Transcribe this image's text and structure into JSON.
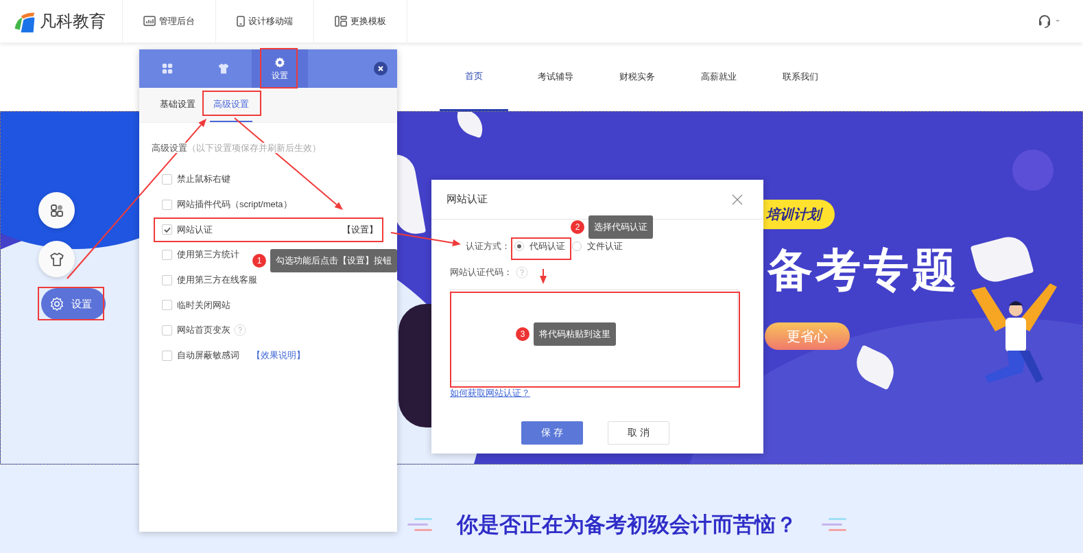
{
  "top_bar": {
    "logo": "凡科教育",
    "tools": [
      {
        "kind": "chart",
        "label": "管理后台"
      },
      {
        "kind": "phone",
        "label": "设计移动端"
      },
      {
        "kind": "layout",
        "label": "更换模板"
      }
    ]
  },
  "site_nav": {
    "items": [
      {
        "label": "首页",
        "selected": true
      },
      {
        "label": "考试辅导",
        "selected": false
      },
      {
        "label": "财税实务",
        "selected": false
      },
      {
        "label": "高薪就业",
        "selected": false
      },
      {
        "label": "联系我们",
        "selected": false
      }
    ]
  },
  "banner": {
    "badge": "培训计划",
    "headline": "备考专题",
    "button": "更省心"
  },
  "float_buttons": [
    {
      "kind": "grid"
    },
    {
      "kind": "shirt"
    },
    {
      "kind": "gear",
      "label": "设置"
    }
  ],
  "panel": {
    "tabs": [
      {
        "kind": "grid",
        "selected": false
      },
      {
        "kind": "shirt",
        "selected": false
      },
      {
        "kind": "gear",
        "label": "设置",
        "selected": true
      }
    ],
    "subtabs": [
      {
        "label": "基础设置",
        "selected": false
      },
      {
        "label": "高级设置",
        "selected": true
      }
    ],
    "section_title": "高级设置",
    "section_note": "（以下设置项保存并刷新后生效）",
    "options": [
      {
        "label": "禁止鼠标右键",
        "checked": false
      },
      {
        "label": "网站插件代码（script/meta）",
        "checked": false
      },
      {
        "label": "网站认证",
        "checked": true,
        "action": "【设置】"
      },
      {
        "label": "使用第三方统计",
        "checked": false
      },
      {
        "label": "使用第三方在线客服",
        "checked": false
      },
      {
        "label": "临时关闭网站",
        "checked": false
      },
      {
        "label": "网站首页变灰",
        "checked": false,
        "help": true
      },
      {
        "label": "自动屏蔽敏感词",
        "checked": false,
        "link": "【效果说明】"
      }
    ]
  },
  "dialog": {
    "title": "网站认证",
    "method_label": "认证方式：",
    "methods": [
      {
        "label": "代码认证",
        "selected": true
      },
      {
        "label": "文件认证",
        "selected": false
      }
    ],
    "code_label": "网站认证代码：",
    "help_link": "如何获取网站认证？",
    "buttons": [
      {
        "kind": "primary",
        "label": "保 存"
      },
      {
        "kind": "default",
        "label": "取 消"
      }
    ]
  },
  "annotations": [
    {
      "number": "1",
      "text": "勾选功能后点击【设置】按钮"
    },
    {
      "number": "2",
      "text": "选择代码认证"
    },
    {
      "number": "3",
      "text": "将代码粘贴到这里"
    }
  ],
  "section_heading": "你是否正在为备考初级会计而苦恼？"
}
